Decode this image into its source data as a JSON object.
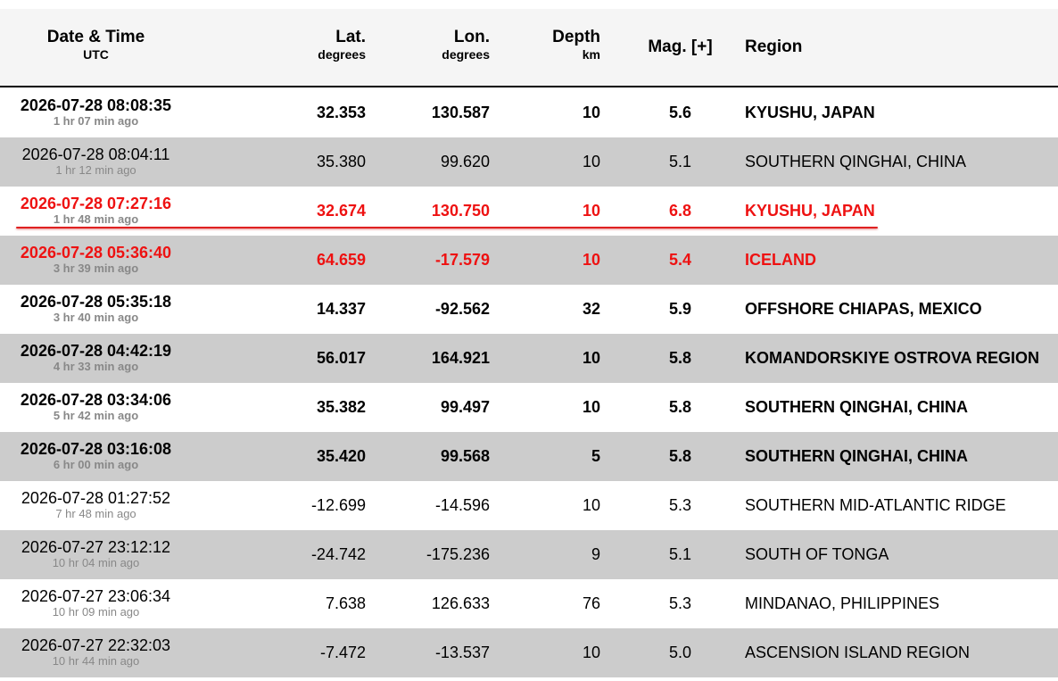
{
  "header": {
    "date": "Date & Time",
    "date_sub": "UTC",
    "lat": "Lat.",
    "lat_sub": "degrees",
    "lon": "Lon.",
    "lon_sub": "degrees",
    "depth": "Depth",
    "depth_sub": "km",
    "mag": "Mag.",
    "mag_plus": "[+]",
    "region": "Region"
  },
  "colors": {
    "highlight": "#ee1111",
    "shade": "#cccccc",
    "header_bg": "#f5f5f5",
    "ago_text": "#888888"
  },
  "rows": [
    {
      "datetime": "2026-07-28 08:08:35",
      "ago": "1 hr 07 min ago",
      "lat": "32.353",
      "lon": "130.587",
      "depth": "10",
      "mag": "5.6",
      "region": "KYUSHU, JAPAN",
      "style": "bold"
    },
    {
      "datetime": "2026-07-28 08:04:11",
      "ago": "1 hr 12 min ago",
      "lat": "35.380",
      "lon": "99.620",
      "depth": "10",
      "mag": "5.1",
      "region": "SOUTHERN QINGHAI, CHINA",
      "style": "normal"
    },
    {
      "datetime": "2026-07-28 07:27:16",
      "ago": "1 hr 48 min ago",
      "lat": "32.674",
      "lon": "130.750",
      "depth": "10",
      "mag": "6.8",
      "region": "KYUSHU, JAPAN",
      "style": "red"
    },
    {
      "datetime": "2026-07-28 05:36:40",
      "ago": "3 hr 39 min ago",
      "lat": "64.659",
      "lon": "-17.579",
      "depth": "10",
      "mag": "5.4",
      "region": "ICELAND",
      "style": "red"
    },
    {
      "datetime": "2026-07-28 05:35:18",
      "ago": "3 hr 40 min ago",
      "lat": "14.337",
      "lon": "-92.562",
      "depth": "32",
      "mag": "5.9",
      "region": "OFFSHORE CHIAPAS, MEXICO",
      "style": "bold"
    },
    {
      "datetime": "2026-07-28 04:42:19",
      "ago": "4 hr 33 min ago",
      "lat": "56.017",
      "lon": "164.921",
      "depth": "10",
      "mag": "5.8",
      "region": "KOMANDORSKIYE OSTROVA REGION",
      "style": "bold"
    },
    {
      "datetime": "2026-07-28 03:34:06",
      "ago": "5 hr 42 min ago",
      "lat": "35.382",
      "lon": "99.497",
      "depth": "10",
      "mag": "5.8",
      "region": "SOUTHERN QINGHAI, CHINA",
      "style": "bold"
    },
    {
      "datetime": "2026-07-28 03:16:08",
      "ago": "6 hr 00 min ago",
      "lat": "35.420",
      "lon": "99.568",
      "depth": "5",
      "mag": "5.8",
      "region": "SOUTHERN QINGHAI, CHINA",
      "style": "bold"
    },
    {
      "datetime": "2026-07-28 01:27:52",
      "ago": "7 hr 48 min ago",
      "lat": "-12.699",
      "lon": "-14.596",
      "depth": "10",
      "mag": "5.3",
      "region": "SOUTHERN MID-ATLANTIC RIDGE",
      "style": "normal"
    },
    {
      "datetime": "2026-07-27 23:12:12",
      "ago": "10 hr 04 min ago",
      "lat": "-24.742",
      "lon": "-175.236",
      "depth": "9",
      "mag": "5.1",
      "region": "SOUTH OF TONGA",
      "style": "normal"
    },
    {
      "datetime": "2026-07-27 23:06:34",
      "ago": "10 hr 09 min ago",
      "lat": "7.638",
      "lon": "126.633",
      "depth": "76",
      "mag": "5.3",
      "region": "MINDANAO, PHILIPPINES",
      "style": "normal"
    },
    {
      "datetime": "2026-07-27 22:32:03",
      "ago": "10 hr 44 min ago",
      "lat": "-7.472",
      "lon": "-13.537",
      "depth": "10",
      "mag": "5.0",
      "region": "ASCENSION ISLAND REGION",
      "style": "normal"
    }
  ]
}
